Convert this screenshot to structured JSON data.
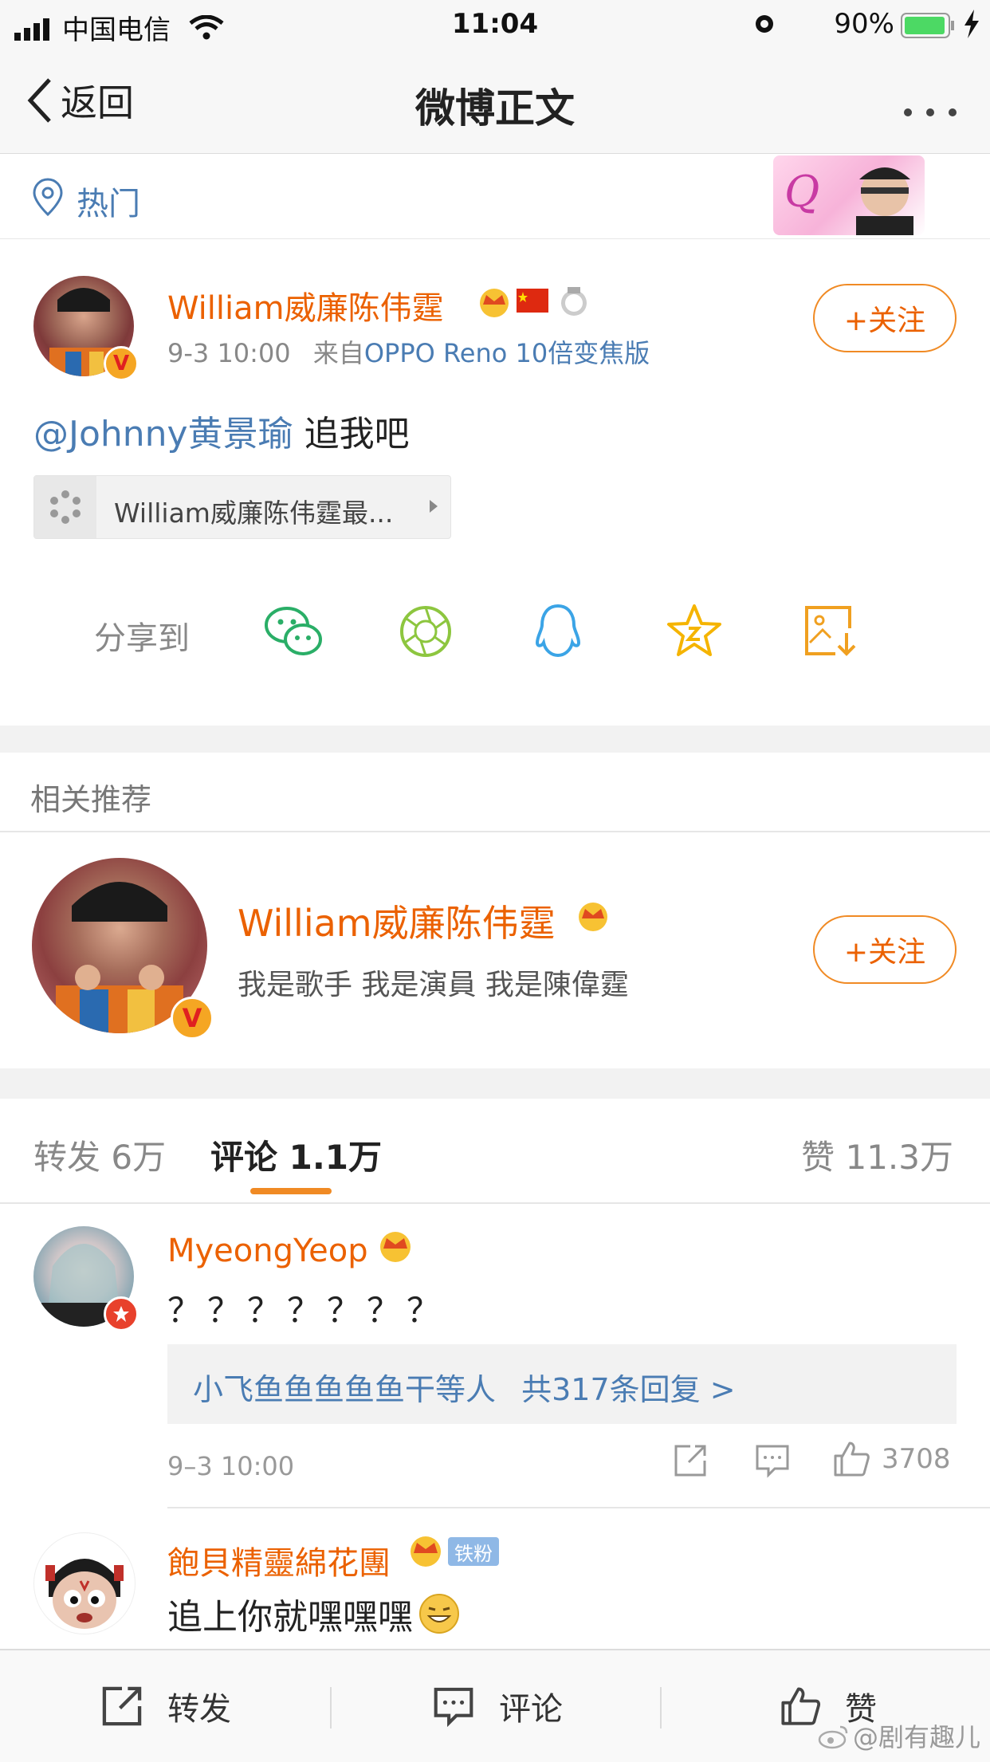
{
  "status_bar": {
    "carrier": "中国电信",
    "time": "11:04",
    "battery": "90%"
  },
  "nav": {
    "back_label": "返回",
    "title": "微博正文"
  },
  "hot_label": "热门",
  "post": {
    "author": "William威廉陈伟霆",
    "time": "9-3 10:00",
    "source_prefix": "来自",
    "source": "OPPO Reno 10倍变焦版",
    "mention": "@Johnny黄景瑜",
    "text": " 追我吧",
    "card_text": "William威廉陈伟霆最...",
    "follow_label": "+关注",
    "share_label": "分享到"
  },
  "recommend": {
    "header": "相关推荐",
    "name": "William威廉陈伟霆",
    "desc": "我是歌手 我是演員 我是陳偉霆",
    "follow_label": "+关注"
  },
  "tabs": {
    "repost": "转发 6万",
    "comment": "评论 1.1万",
    "like": "赞 11.3万"
  },
  "comments": [
    {
      "name": "MyeongYeop",
      "text": "？？？？？？？",
      "replies": "小飞鱼鱼鱼鱼鱼干等人",
      "replies_count": "共317条回复 >",
      "time": "9–3 10:00",
      "likes": "3708"
    },
    {
      "name": "飽貝精靈綿花團",
      "badge": "铁粉",
      "text": "追上你就嘿嘿嘿"
    }
  ],
  "bottom_bar": {
    "repost": "转发",
    "comment": "评论",
    "like": "赞",
    "watermark": "@剧有趣儿"
  },
  "colors": {
    "accent": "#eb6100",
    "link": "#4a7cb3"
  }
}
